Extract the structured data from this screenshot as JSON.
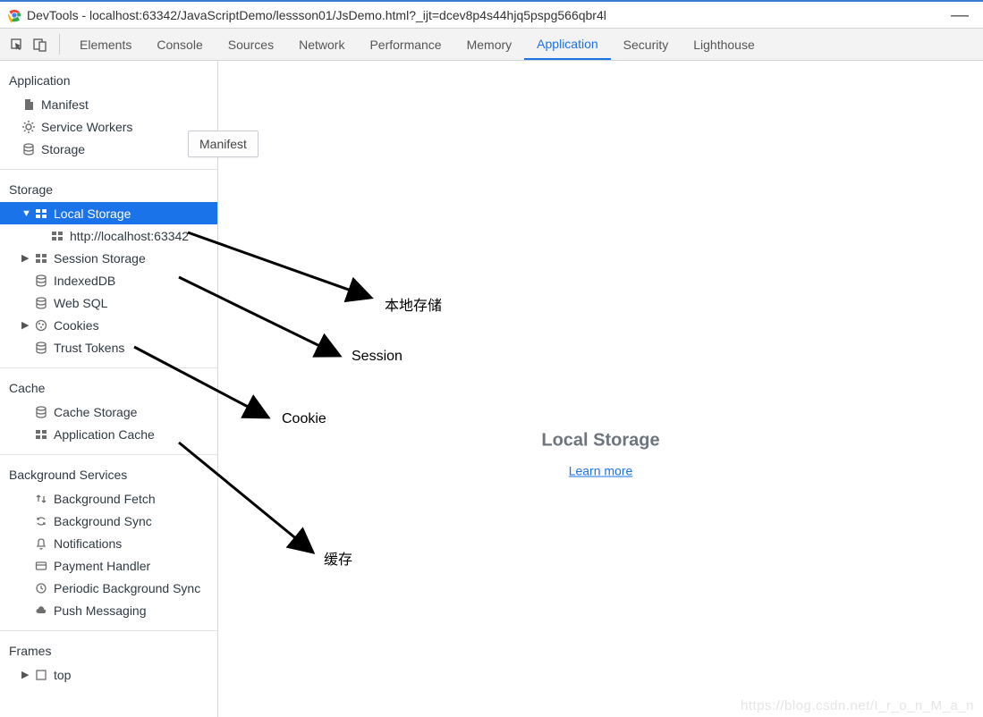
{
  "window": {
    "title": "DevTools - localhost:63342/JavaScriptDemo/lessson01/JsDemo.html?_ijt=dcev8p4s44hjq5pspg566qbr4l"
  },
  "tabs": {
    "elements": "Elements",
    "console": "Console",
    "sources": "Sources",
    "network": "Network",
    "performance": "Performance",
    "memory": "Memory",
    "application": "Application",
    "security": "Security",
    "lighthouse": "Lighthouse"
  },
  "tooltip": {
    "manifest": "Manifest"
  },
  "sidebar": {
    "application": {
      "title": "Application",
      "manifest": "Manifest",
      "service_workers": "Service Workers",
      "storage": "Storage"
    },
    "storage": {
      "title": "Storage",
      "local_storage": "Local Storage",
      "local_storage_origin": "http://localhost:63342",
      "session_storage": "Session Storage",
      "indexeddb": "IndexedDB",
      "web_sql": "Web SQL",
      "cookies": "Cookies",
      "trust_tokens": "Trust Tokens"
    },
    "cache": {
      "title": "Cache",
      "cache_storage": "Cache Storage",
      "application_cache": "Application Cache"
    },
    "background": {
      "title": "Background Services",
      "background_fetch": "Background Fetch",
      "background_sync": "Background Sync",
      "notifications": "Notifications",
      "payment_handler": "Payment Handler",
      "periodic_bg_sync": "Periodic Background Sync",
      "push_messaging": "Push Messaging"
    },
    "frames": {
      "title": "Frames",
      "top": "top"
    }
  },
  "content": {
    "heading": "Local Storage",
    "learn_more": "Learn more"
  },
  "annotations": {
    "local_storage": "本地存储",
    "session": "Session",
    "cookie": "Cookie",
    "cache": "缓存"
  },
  "watermark": "https://blog.csdn.net/I_r_o_n_M_a_n"
}
